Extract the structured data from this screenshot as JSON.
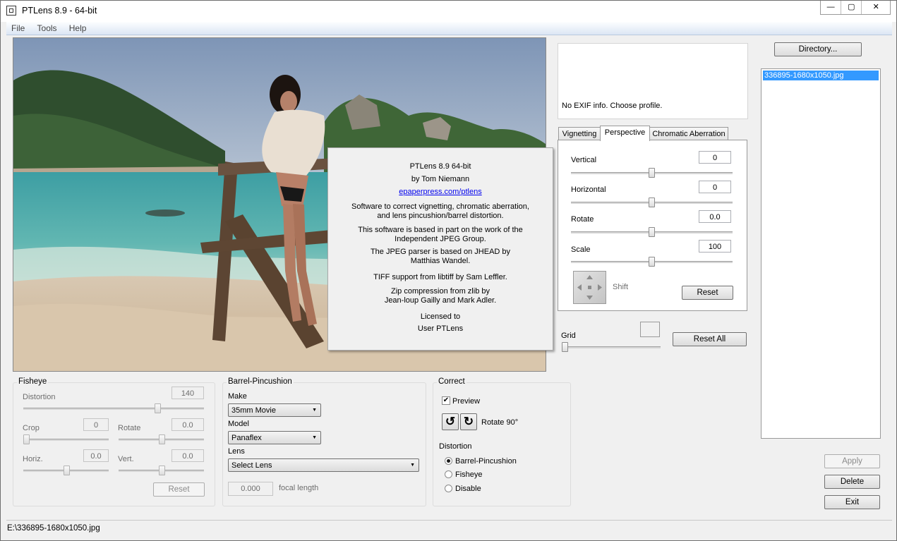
{
  "window": {
    "title": "PTLens 8.9 - 64-bit",
    "controls": [
      "—",
      "▢",
      "✕"
    ]
  },
  "menu": [
    "File",
    "Tools",
    "Help"
  ],
  "about": {
    "lines": [
      "PTLens 8.9  64-bit",
      "by Tom Niemann",
      "epaperpress.com/ptlens",
      "Software to correct vignetting, chromatic aberration,",
      "and lens pincushion/barrel distortion.",
      "This software is based in part on the work of the",
      "Independent JPEG Group.",
      "The JPEG parser is based on JHEAD by",
      "Matthias Wandel.",
      "TIFF support from libtiff by Sam Leffler.",
      "Zip compression from zlib by",
      "Jean-loup Gailly and Mark Adler.",
      "Licensed to",
      "User PTLens"
    ]
  },
  "exif": {
    "message": "No EXIF info. Choose profile."
  },
  "tabs": [
    "Vignetting",
    "Perspective",
    "Chromatic Aberration"
  ],
  "perspective": {
    "vertical": {
      "label": "Vertical",
      "value": "0",
      "pos": 0.5
    },
    "horizontal": {
      "label": "Horizontal",
      "value": "0",
      "pos": 0.5
    },
    "rotate": {
      "label": "Rotate",
      "value": "0.0",
      "pos": 0.5
    },
    "scale": {
      "label": "Scale",
      "value": "100",
      "pos": 0.5
    },
    "shift_label": "Shift",
    "reset_label": "Reset"
  },
  "grid": {
    "label": "Grid",
    "pos": 0.0
  },
  "reset_all_label": "Reset All",
  "directory_label": "Directory...",
  "files": [
    "336895-1680x1050.jpg"
  ],
  "actions": {
    "apply": "Apply",
    "delete": "Delete",
    "exit": "Exit"
  },
  "fisheye": {
    "title": "Fisheye",
    "distortion_label": "Distortion",
    "distortion_value": "140",
    "crop_label": "Crop",
    "crop_value": "0",
    "rotate_label": "Rotate",
    "rotate_value": "0.0",
    "horiz_label": "Horiz.",
    "horiz_value": "0.0",
    "vert_label": "Vert.",
    "vert_value": "0.0",
    "reset_label": "Reset"
  },
  "barrel": {
    "title": "Barrel-Pincushion",
    "make_label": "Make",
    "make_value": "35mm Movie",
    "model_label": "Model",
    "model_value": "Panaflex",
    "lens_label": "Lens",
    "lens_value": "Select Lens",
    "focal_value": "0.000",
    "focal_label": "focal length"
  },
  "correct": {
    "title": "Correct",
    "preview_label": "Preview",
    "rotate_label": "Rotate 90°",
    "distortion_title": "Distortion",
    "options": [
      "Barrel-Pincushion",
      "Fisheye",
      "Disable"
    ],
    "selected": "Barrel-Pincushion"
  },
  "status": {
    "path": "E:\\336895-1680x1050.jpg"
  },
  "colors": {
    "selection": "#3399ff",
    "link": "#0000ee"
  }
}
